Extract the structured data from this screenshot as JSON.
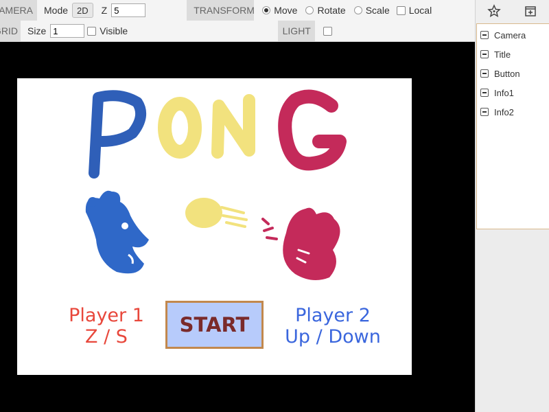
{
  "toolbar": {
    "camera": {
      "section": "CAMERA",
      "mode_label": "Mode",
      "mode_value": "2D",
      "z_label": "Z",
      "z_value": "5"
    },
    "transform": {
      "section": "TRANSFORM",
      "options": [
        "Move",
        "Rotate",
        "Scale"
      ],
      "selected": "Move",
      "local_label": "Local"
    },
    "grid": {
      "section": "GRID",
      "size_label": "Size",
      "size_value": "1",
      "visible_label": "Visible"
    },
    "light": {
      "section": "LIGHT"
    }
  },
  "side_panel": {
    "icons": [
      "star-icon",
      "add-icon"
    ],
    "hierarchy": [
      "Camera",
      "Title",
      "Button",
      "Info1",
      "Info2"
    ]
  },
  "scene": {
    "title": "PONG",
    "player1": {
      "name": "Player 1",
      "keys": "Z / S"
    },
    "player2": {
      "name": "Player 2",
      "keys": "Up / Down"
    },
    "start_label": "START",
    "colors": {
      "p1": "#e8473b",
      "p2": "#3a66dd",
      "title_blue": "#2f5fb8",
      "title_yellow": "#f2e27e",
      "title_pink": "#c42a5a"
    }
  }
}
